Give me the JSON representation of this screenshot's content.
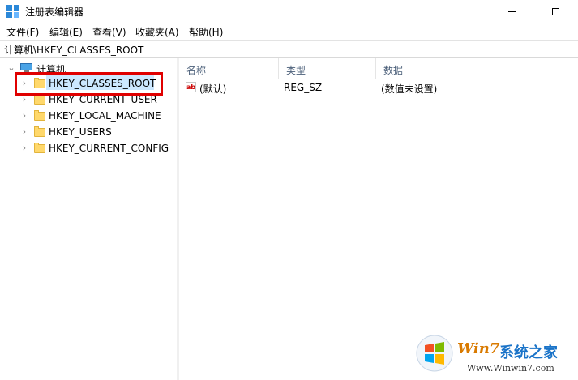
{
  "window": {
    "title": "注册表编辑器",
    "app_icon": "registry-editor-icon"
  },
  "menu": [
    {
      "label": "文件(F)"
    },
    {
      "label": "编辑(E)"
    },
    {
      "label": "查看(V)"
    },
    {
      "label": "收藏夹(A)"
    },
    {
      "label": "帮助(H)"
    }
  ],
  "address": "计算机\\HKEY_CLASSES_ROOT",
  "tree": {
    "root": "计算机",
    "items": [
      {
        "label": "HKEY_CLASSES_ROOT",
        "selected": true
      },
      {
        "label": "HKEY_CURRENT_USER"
      },
      {
        "label": "HKEY_LOCAL_MACHINE"
      },
      {
        "label": "HKEY_USERS"
      },
      {
        "label": "HKEY_CURRENT_CONFIG"
      }
    ]
  },
  "list": {
    "columns": [
      "名称",
      "类型",
      "数据"
    ],
    "rows": [
      {
        "name": "(默认)",
        "type": "REG_SZ",
        "data": "(数值未设置)",
        "icon": "string-value-icon"
      }
    ]
  },
  "watermark": {
    "brand_a": "Win7",
    "brand_b": "系统之家",
    "url": "Www.Winwin7.com"
  },
  "colors": {
    "selection": "#cce8ff",
    "highlight_box": "#e00000",
    "folder": "#ffd86b"
  }
}
